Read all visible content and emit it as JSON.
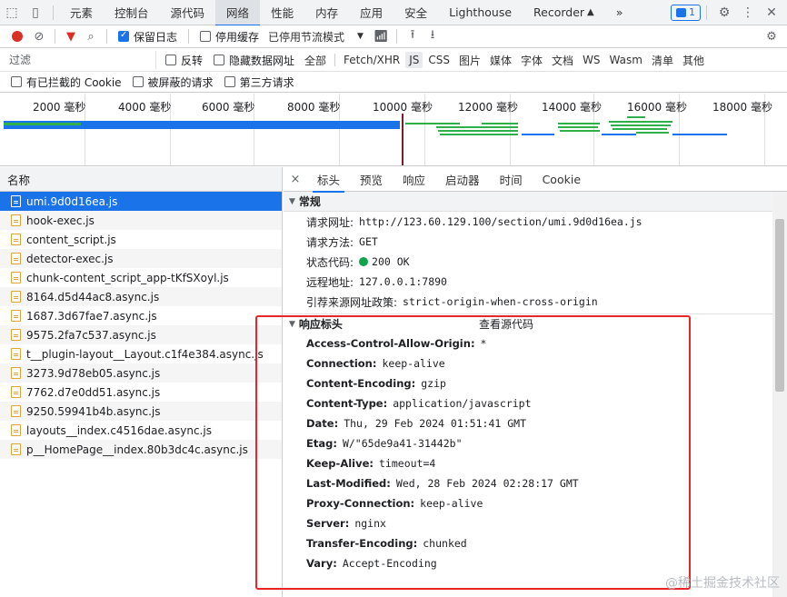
{
  "topbar": {
    "tabs": [
      {
        "label": "元素"
      },
      {
        "label": "控制台"
      },
      {
        "label": "源代码"
      },
      {
        "label": "网络",
        "active": true
      },
      {
        "label": "性能"
      },
      {
        "label": "内存"
      },
      {
        "label": "应用"
      },
      {
        "label": "安全"
      },
      {
        "label": "Lighthouse"
      },
      {
        "label": "Recorder",
        "glyph": "▲"
      },
      {
        "label": "»"
      }
    ],
    "issues_count": "1"
  },
  "toolbar": {
    "preserve_log": "保留日志",
    "disable_cache": "停用缓存",
    "throttling": "已停用节流模式"
  },
  "filter": {
    "placeholder": "过滤",
    "invert": "反转",
    "hide_data_urls": "隐藏数据网址",
    "types": [
      "全部",
      "Fetch/XHR",
      "JS",
      "CSS",
      "图片",
      "媒体",
      "字体",
      "文档",
      "WS",
      "Wasm",
      "清单",
      "其他"
    ],
    "selected_type": "JS"
  },
  "row3": {
    "blocked_cookies": "有已拦截的 Cookie",
    "blocked_requests": "被屏蔽的请求",
    "third_party": "第三方请求"
  },
  "timeline": {
    "ticks": [
      "2000 毫秒",
      "4000 毫秒",
      "6000 毫秒",
      "8000 毫秒",
      "10000 毫秒",
      "12000 毫秒",
      "14000 毫秒",
      "16000 毫秒",
      "18000 毫秒"
    ]
  },
  "list": {
    "header": "名称",
    "items": [
      "umi.9d0d16ea.js",
      "hook-exec.js",
      "content_script.js",
      "detector-exec.js",
      "chunk-content_script_app-tKfSXoyl.js",
      "8164.d5d44ac8.async.js",
      "1687.3d67fae7.async.js",
      "9575.2fa7c537.async.js",
      "t__plugin-layout__Layout.c1f4e384.async.js",
      "3273.9d78eb05.async.js",
      "7762.d7e0dd51.async.js",
      "9250.59941b4b.async.js",
      "layouts__index.c4516dae.async.js",
      "p__HomePage__index.80b3dc4c.async.js"
    ],
    "selected_index": 0
  },
  "detail": {
    "close": "×",
    "tabs": [
      "标头",
      "预览",
      "响应",
      "启动器",
      "时间",
      "Cookie"
    ],
    "active_tab": "标头",
    "general_title": "常规",
    "general": [
      {
        "k": "请求网址:",
        "v": "http://123.60.129.100/section/umi.9d0d16ea.js"
      },
      {
        "k": "请求方法:",
        "v": "GET"
      },
      {
        "k": "状态代码:",
        "v": "200 OK",
        "status_color": "#0fa34d"
      },
      {
        "k": "远程地址:",
        "v": "127.0.0.1:7890"
      },
      {
        "k": "引荐来源网址政策:",
        "v": "strict-origin-when-cross-origin"
      }
    ],
    "response_title": "响应标头",
    "view_source": "查看源代码",
    "response_headers": [
      {
        "k": "Access-Control-Allow-Origin:",
        "v": "*"
      },
      {
        "k": "Connection:",
        "v": "keep-alive"
      },
      {
        "k": "Content-Encoding:",
        "v": "gzip"
      },
      {
        "k": "Content-Type:",
        "v": "application/javascript"
      },
      {
        "k": "Date:",
        "v": "Thu, 29 Feb 2024 01:51:41 GMT"
      },
      {
        "k": "Etag:",
        "v": "W/\"65de9a41-31442b\""
      },
      {
        "k": "Keep-Alive:",
        "v": "timeout=4"
      },
      {
        "k": "Last-Modified:",
        "v": "Wed, 28 Feb 2024 02:28:17 GMT"
      },
      {
        "k": "Proxy-Connection:",
        "v": "keep-alive"
      },
      {
        "k": "Server:",
        "v": "nginx"
      },
      {
        "k": "Transfer-Encoding:",
        "v": "chunked"
      },
      {
        "k": "Vary:",
        "v": "Accept-Encoding"
      }
    ]
  },
  "watermark": "@稀土掘金技术社区",
  "colors": {
    "accent": "#1a73e8",
    "highlight_box": "#e8252a",
    "record": "#d93025"
  }
}
